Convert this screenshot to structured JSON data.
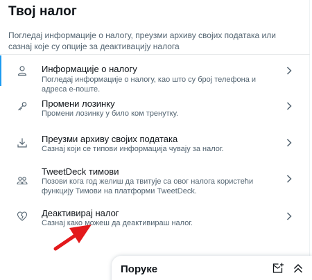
{
  "page": {
    "title": "Твој налог",
    "description": "Погледај информације о налогу, преузми архиву својих података или сазнај које су опције за деактивацију налога"
  },
  "items": [
    {
      "title": "Информације о налогу",
      "desc": "Погледај информације о налогу, као што су број телефона и адреса е-поште.",
      "icon": "person-icon"
    },
    {
      "title": "Промени лозинку",
      "desc": "Промени лозинку у било ком тренутку.",
      "icon": "key-icon"
    },
    {
      "title": "Преузми архиву својих података",
      "desc": "Сазнај који се типови информација чувају за налог.",
      "icon": "download-icon"
    },
    {
      "title": "TweetDeck тимови",
      "desc": "Позови кога год желиш да твитује са овог налога користећи функцију Тимови на платформи TweetDeck.",
      "icon": "people-icon"
    },
    {
      "title": "Деактивирај налог",
      "desc": "Сазнај како можеш да деактивираш налог.",
      "icon": "broken-heart-icon"
    }
  ],
  "messages": {
    "title": "Поруке"
  },
  "colors": {
    "accent": "#1d9bf0",
    "annotation_arrow": "#e3191b",
    "secondary_text": "#536471"
  }
}
